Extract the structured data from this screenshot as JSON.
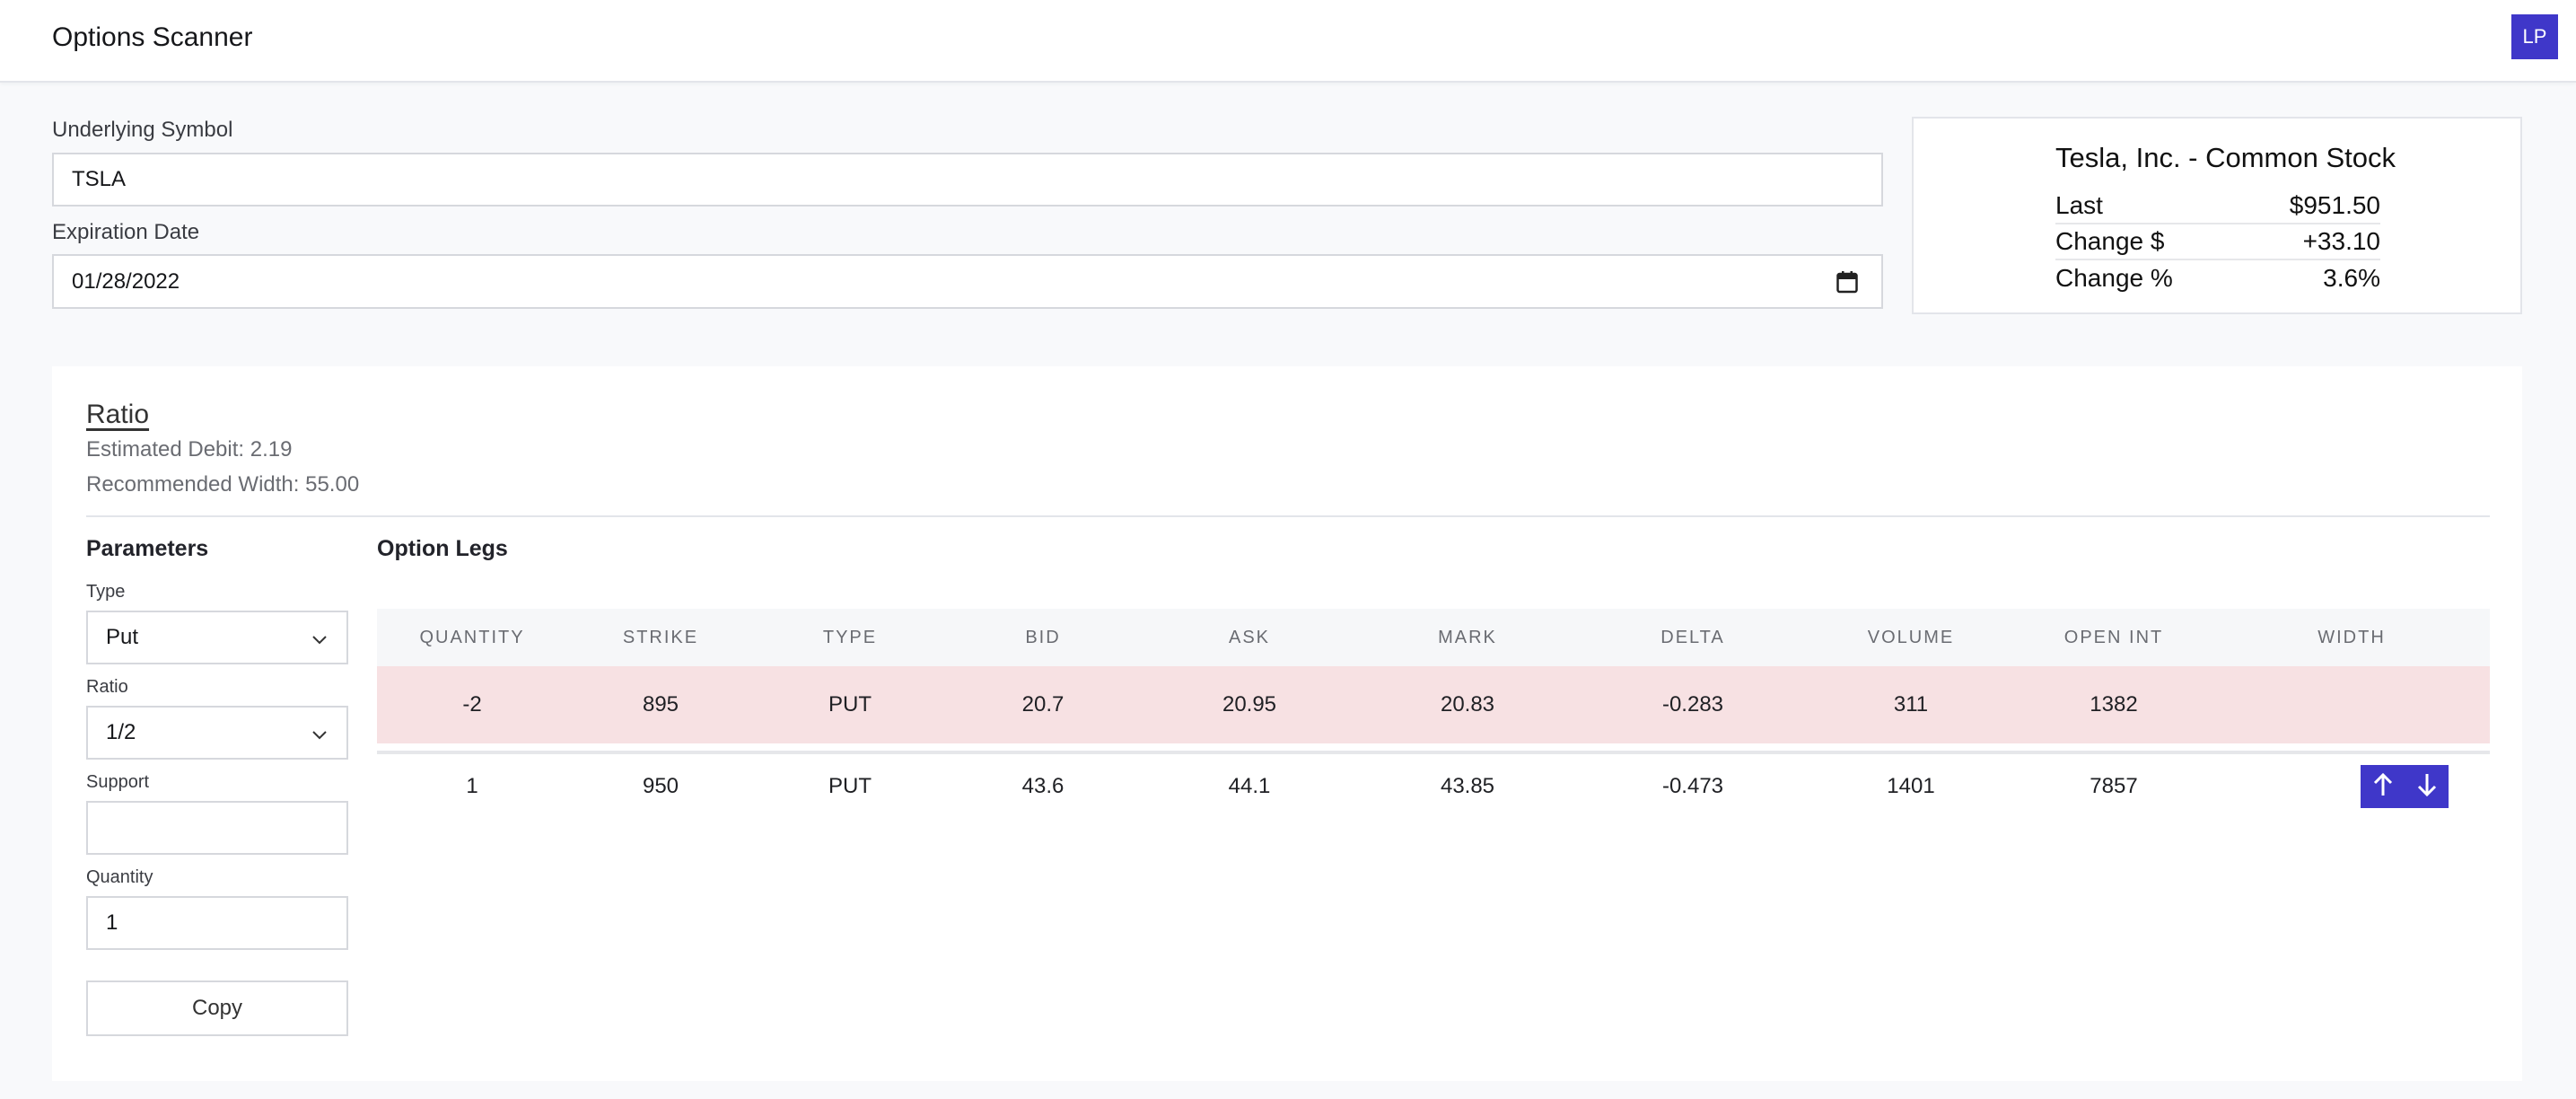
{
  "header": {
    "title": "Options Scanner",
    "avatar_initials": "LP"
  },
  "form": {
    "symbol_label": "Underlying Symbol",
    "symbol_value": "TSLA",
    "expiration_label": "Expiration Date",
    "expiration_value": "01/28/2022"
  },
  "quote": {
    "name": "Tesla, Inc. - Common Stock",
    "rows": [
      {
        "label": "Last",
        "value": "$951.50"
      },
      {
        "label": "Change $",
        "value": "+33.10"
      },
      {
        "label": "Change %",
        "value": "3.6%"
      }
    ]
  },
  "strategy": {
    "title": "Ratio",
    "estimated_debit": "Estimated Debit: 2.19",
    "recommended_width": "Recommended Width: 55.00"
  },
  "parameters": {
    "heading": "Parameters",
    "type_label": "Type",
    "type_value": "Put",
    "ratio_label": "Ratio",
    "ratio_value": "1/2",
    "support_label": "Support",
    "support_value": "",
    "quantity_label": "Quantity",
    "quantity_value": "1",
    "copy_label": "Copy"
  },
  "legs": {
    "heading": "Option Legs",
    "columns": [
      "QUANTITY",
      "STRIKE",
      "TYPE",
      "BID",
      "ASK",
      "MARK",
      "DELTA",
      "VOLUME",
      "OPEN INT",
      "WIDTH"
    ],
    "rows": [
      [
        "-2",
        "895",
        "PUT",
        "20.7",
        "20.95",
        "20.83",
        "-0.283",
        "311",
        "1382",
        ""
      ],
      [
        "1",
        "950",
        "PUT",
        "43.6",
        "44.1",
        "43.85",
        "-0.473",
        "1401",
        "7857",
        ""
      ]
    ]
  },
  "colors": {
    "accent": "#3f37c9",
    "row_highlight": "#f7e1e3",
    "page_bg": "#f8f9fb"
  },
  "icons": [
    "calendar-icon",
    "chevron-down-icon",
    "arrow-up-icon",
    "arrow-down-icon"
  ]
}
